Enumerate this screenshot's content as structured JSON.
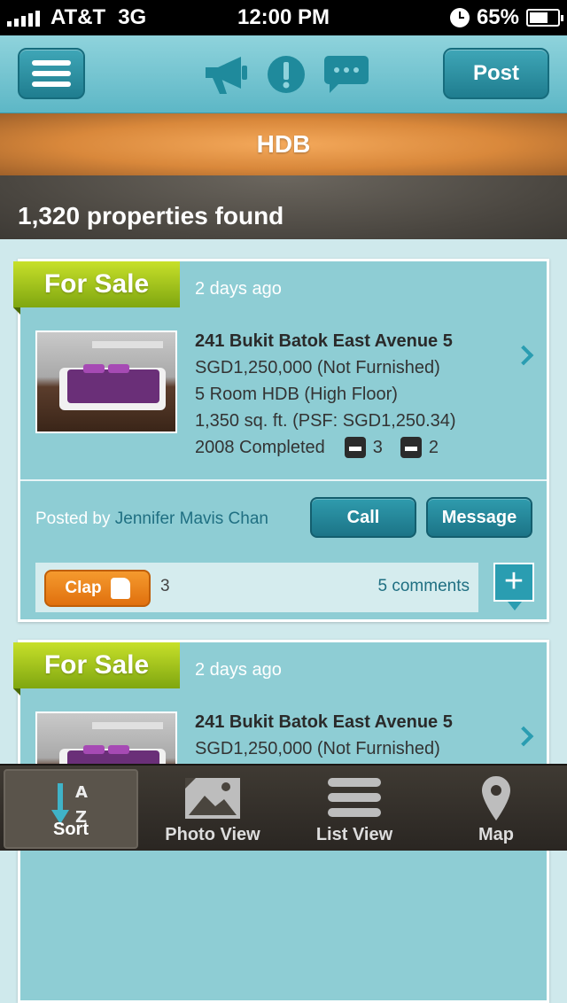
{
  "status_bar": {
    "carrier": "AT&T",
    "network": "3G",
    "time": "12:00 PM",
    "battery": "65%"
  },
  "nav_bar": {
    "post_label": "Post"
  },
  "category": {
    "title": "HDB"
  },
  "results": {
    "count_text": "1,320 properties found"
  },
  "listings": [
    {
      "status": "For Sale",
      "posted_ago": "2 days ago",
      "address": "241 Bukit Batok East Avenue 5",
      "price": "SGD1,250,000 (Not Furnished)",
      "type": "5 Room HDB (High Floor)",
      "size": "1,350 sq. ft. (PSF: SGD1,250.34)",
      "completed": "2008 Completed",
      "bedrooms": "3",
      "bathrooms": "2",
      "posted_by_label": "Posted by",
      "agent": "Jennifer Mavis Chan",
      "call_label": "Call",
      "message_label": "Message",
      "clap_label": "Clap",
      "clap_count": "3",
      "comments": "5 comments"
    },
    {
      "status": "For Sale",
      "posted_ago": "2 days ago",
      "address": "241 Bukit Batok East Avenue 5",
      "price": "SGD1,250,000 (Not Furnished)"
    }
  ],
  "tab_bar": {
    "tabs": [
      {
        "label": "Sort",
        "icon": "sort-az-icon",
        "active": true
      },
      {
        "label": "Photo View",
        "icon": "photo-icon"
      },
      {
        "label": "List View",
        "icon": "list-icon"
      },
      {
        "label": "Map",
        "icon": "map-pin-icon"
      }
    ]
  },
  "colors": {
    "accent": "#2a9db1",
    "ribbon": "#9bc21a",
    "clap": "#f08a20",
    "category": "#e0913f"
  }
}
